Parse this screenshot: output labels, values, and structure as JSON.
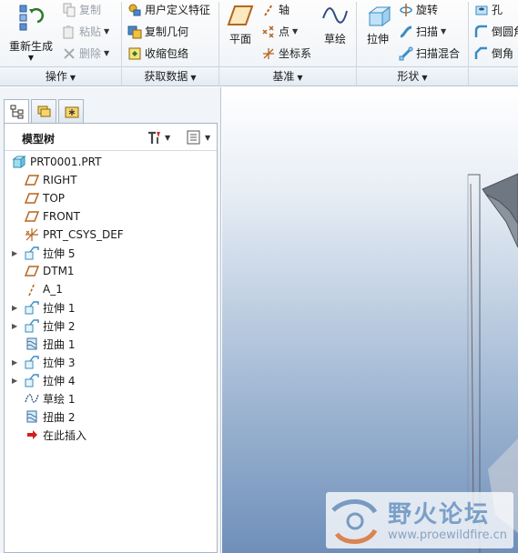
{
  "ribbon": {
    "operations": {
      "label": "操作",
      "regenerate": "重新生成",
      "copy": "复制",
      "paste": "粘贴",
      "delete": "删除"
    },
    "get_data": {
      "label": "获取数据",
      "udf": "用户定义特征",
      "copy_geom": "复制几何",
      "shrinkwrap": "收缩包络"
    },
    "datum": {
      "label": "基准",
      "plane": "平面",
      "axis": "轴",
      "point": "点",
      "csys": "坐标系",
      "sketch": "草绘"
    },
    "shapes": {
      "label": "形状",
      "extrude": "拉伸",
      "revolve": "旋转",
      "sweep": "扫描",
      "swept_blend": "扫描混合"
    },
    "engineering": {
      "hole": "孔",
      "round": "倒圆角",
      "chamfer": "倒角"
    }
  },
  "model_tree": {
    "title": "模型树",
    "items": [
      {
        "label": "PRT0001.PRT",
        "icon": "part-icon",
        "expandable": false,
        "indent": 0
      },
      {
        "label": "RIGHT",
        "icon": "datum-plane-icon",
        "expandable": false,
        "indent": 1
      },
      {
        "label": "TOP",
        "icon": "datum-plane-icon",
        "expandable": false,
        "indent": 1
      },
      {
        "label": "FRONT",
        "icon": "datum-plane-icon",
        "expandable": false,
        "indent": 1
      },
      {
        "label": "PRT_CSYS_DEF",
        "icon": "csys-icon",
        "expandable": false,
        "indent": 1
      },
      {
        "label": "拉伸 5",
        "icon": "extrude-icon",
        "expandable": true,
        "indent": 1
      },
      {
        "label": "DTM1",
        "icon": "datum-plane-icon",
        "expandable": false,
        "indent": 1
      },
      {
        "label": "A_1",
        "icon": "datum-axis-icon",
        "expandable": false,
        "indent": 1
      },
      {
        "label": "拉伸 1",
        "icon": "extrude-icon",
        "expandable": true,
        "indent": 1
      },
      {
        "label": "拉伸 2",
        "icon": "extrude-icon",
        "expandable": true,
        "indent": 1
      },
      {
        "label": "扭曲 1",
        "icon": "warp-icon",
        "expandable": false,
        "indent": 1
      },
      {
        "label": "拉伸 3",
        "icon": "extrude-icon",
        "expandable": true,
        "indent": 1
      },
      {
        "label": "拉伸 4",
        "icon": "extrude-icon",
        "expandable": true,
        "indent": 1
      },
      {
        "label": "草绘 1",
        "icon": "sketch-icon",
        "expandable": false,
        "indent": 1
      },
      {
        "label": "扭曲 2",
        "icon": "warp-icon",
        "expandable": false,
        "indent": 1
      },
      {
        "label": "在此插入",
        "icon": "insert-here-icon",
        "expandable": false,
        "indent": 1
      }
    ]
  },
  "watermark": {
    "title": "野火论坛",
    "url": "www.proewildfire.cn"
  },
  "colors": {
    "ribbon_bg": "#eef2f7",
    "graphics_top": "#ffffff",
    "graphics_bottom": "#6f8fba",
    "accent_blue": "#2f6fb0",
    "watermark_orange": "#e07a2f"
  }
}
